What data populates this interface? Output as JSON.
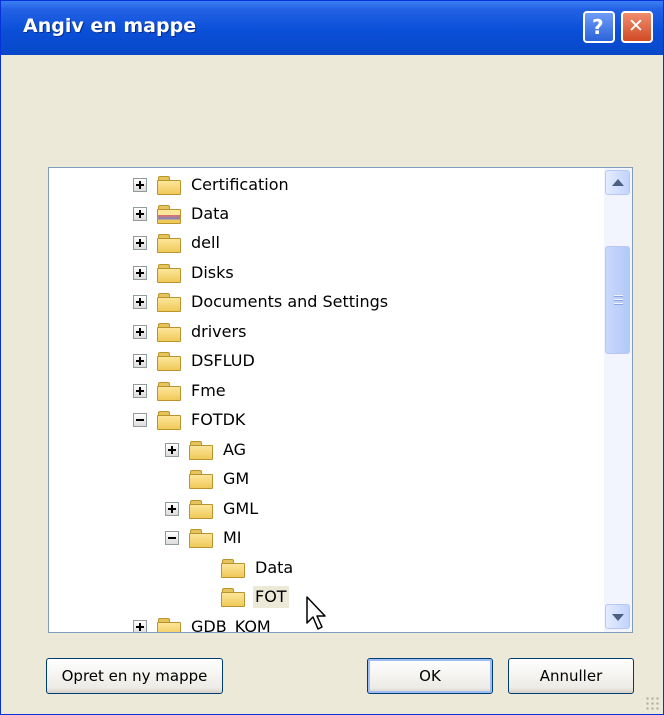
{
  "window": {
    "title": "Angiv en mappe"
  },
  "titlebar": {
    "help_glyph": "?",
    "close_glyph": "✕"
  },
  "tree": {
    "items": [
      {
        "label": "Certification",
        "icon": "folder-icon",
        "expander": "plus"
      },
      {
        "label": "Data",
        "icon": "special-folder-icon",
        "expander": "plus"
      },
      {
        "label": "dell",
        "icon": "folder-icon",
        "expander": "plus"
      },
      {
        "label": "Disks",
        "icon": "folder-icon",
        "expander": "plus"
      },
      {
        "label": "Documents and Settings",
        "icon": "folder-icon",
        "expander": "plus"
      },
      {
        "label": "drivers",
        "icon": "folder-icon",
        "expander": "plus"
      },
      {
        "label": "DSFLUD",
        "icon": "folder-icon",
        "expander": "plus"
      },
      {
        "label": "Fme",
        "icon": "folder-icon",
        "expander": "plus"
      },
      {
        "label": "FOTDK",
        "icon": "folder-icon",
        "expander": "minus"
      },
      {
        "label": "AG",
        "icon": "folder-icon",
        "expander": "plus"
      },
      {
        "label": "GM",
        "icon": "folder-icon",
        "expander": "none"
      },
      {
        "label": "GML",
        "icon": "folder-icon",
        "expander": "plus"
      },
      {
        "label": "MI",
        "icon": "folder-icon",
        "expander": "minus"
      },
      {
        "label": "Data",
        "icon": "folder-icon",
        "expander": "none"
      },
      {
        "label": "FOT",
        "icon": "folder-icon",
        "expander": "none",
        "selected": true
      },
      {
        "label": "GDB_KOM",
        "icon": "folder-icon",
        "expander": "plus"
      }
    ]
  },
  "buttons": {
    "new_folder": "Opret en ny mappe",
    "ok": "OK",
    "cancel": "Annuller"
  },
  "colors": {
    "titlebar": "#0a4fd8",
    "window_bg": "#ece9d8",
    "selection_bg": "#ece9d8"
  }
}
